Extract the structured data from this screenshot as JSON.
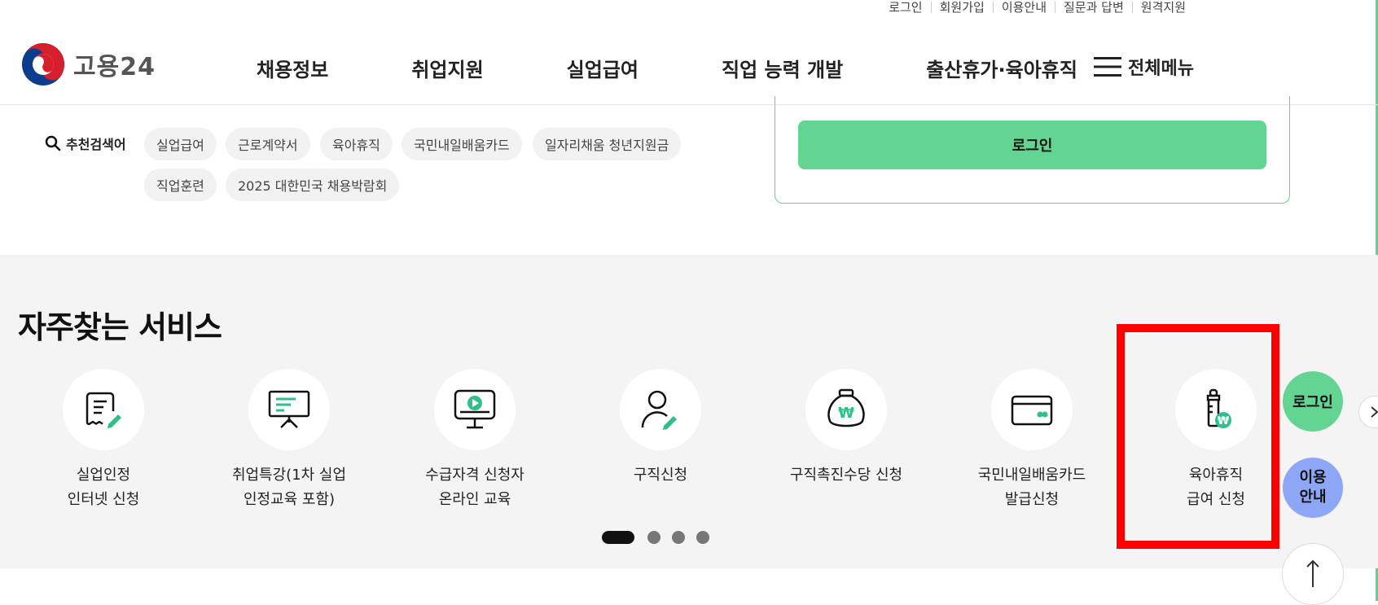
{
  "util_links": [
    "로그인",
    "회원가입",
    "이용안내",
    "질문과 답변",
    "원격지원"
  ],
  "logo": {
    "brand": "고용24"
  },
  "gnb": [
    "채용정보",
    "취업지원",
    "실업급여",
    "직업 능력 개발",
    "출산휴가·육아휴직"
  ],
  "all_menu": "전체메뉴",
  "search": {
    "recommend_label": "추천검색어",
    "keywords": [
      "실업급여",
      "근로계약서",
      "육아휴직",
      "국민내일배움카드",
      "일자리채움 청년지원금",
      "직업훈련",
      "2025 대한민국 채용박람회"
    ]
  },
  "login_button": "로그인",
  "services": {
    "title": "자주찾는 서비스",
    "items": [
      {
        "line1": "실업인정",
        "line2": "인터넷 신청",
        "icon": "document-pen-icon"
      },
      {
        "line1": "취업특강(1차 실업",
        "line2": "인정교육 포함)",
        "icon": "presentation-board-icon"
      },
      {
        "line1": "수급자격 신청자",
        "line2": "온라인 교육",
        "icon": "monitor-play-icon"
      },
      {
        "line1": "구직신청",
        "line2": "",
        "icon": "person-pen-icon"
      },
      {
        "line1": "구직촉진수당 신청",
        "line2": "",
        "icon": "money-bag-icon"
      },
      {
        "line1": "국민내일배움카드",
        "line2": "발급신청",
        "icon": "card-icon"
      },
      {
        "line1": "육아휴직",
        "line2": "급여 신청",
        "icon": "baby-bottle-icon"
      }
    ]
  },
  "floating": {
    "login": "로그인",
    "guide_line1": "이용",
    "guide_line2": "안내"
  },
  "colors": {
    "accent": "#63d491",
    "guide": "#8ea6f6",
    "highlight": "#ff0000"
  }
}
